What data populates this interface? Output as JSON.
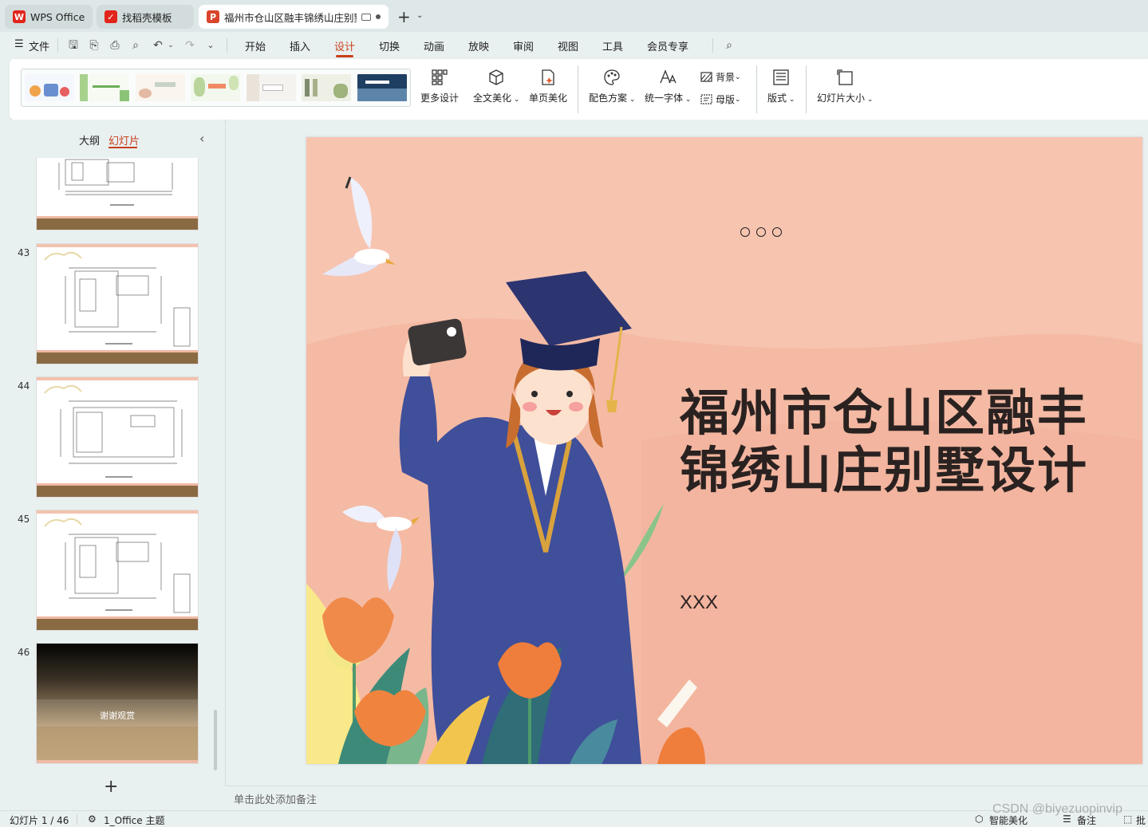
{
  "tabs": [
    {
      "label": "WPS Office",
      "icon": "wps-logo-icon",
      "color": "#e1251b"
    },
    {
      "label": "找稻壳模板",
      "icon": "docer-icon",
      "color": "#e1251b"
    },
    {
      "label": "福州市仓山区融丰锦绣山庄别墅",
      "icon": "presentation-icon",
      "color": "#d9452a"
    }
  ],
  "menu": {
    "file": "文件",
    "items": [
      "开始",
      "插入",
      "设计",
      "切换",
      "动画",
      "放映",
      "审阅",
      "视图",
      "工具",
      "会员专享"
    ],
    "active": "设计"
  },
  "ribbon": {
    "more_design": "更多设计",
    "beautify_all": "全文美化",
    "beautify_single": "单页美化",
    "color_scheme": "配色方案",
    "unify_font": "统一字体",
    "background": "背景",
    "master": "母版",
    "layout": "版式",
    "slide_size": "幻灯片大小"
  },
  "panel": {
    "outline_tab": "大纲",
    "slides_tab": "幻灯片",
    "slide_numbers": [
      "43",
      "44",
      "45",
      "46"
    ],
    "last_slide_text": "谢谢观赏"
  },
  "slide": {
    "title_line1": "福州市仓山区融丰",
    "title_line2": "锦绣山庄别墅设计",
    "subtitle": "XXX"
  },
  "notes_placeholder": "单击此处添加备注",
  "status": {
    "slide_counter": "幻灯片 1 / 46",
    "theme": "1_Office 主题",
    "smart_beautify": "智能美化",
    "notes": "备注",
    "comment": "批"
  },
  "watermark": "CSDN @biyezuopinvip",
  "colors": {
    "accent": "#c8401c",
    "slide_bg": "#f7c4b0",
    "gown": "#3f4f9a"
  }
}
